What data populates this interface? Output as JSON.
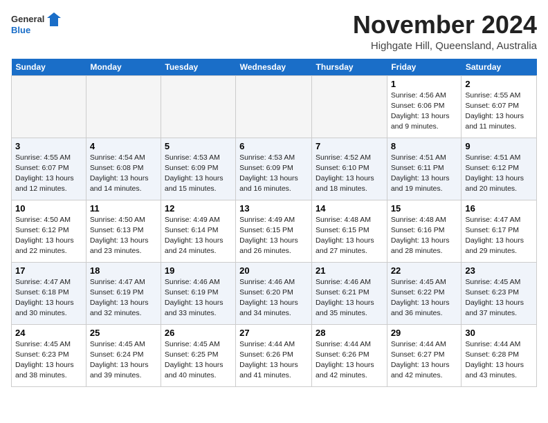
{
  "logo": {
    "general": "General",
    "blue": "Blue"
  },
  "title": "November 2024",
  "subtitle": "Highgate Hill, Queensland, Australia",
  "days_of_week": [
    "Sunday",
    "Monday",
    "Tuesday",
    "Wednesday",
    "Thursday",
    "Friday",
    "Saturday"
  ],
  "weeks": [
    [
      {
        "day": "",
        "info": ""
      },
      {
        "day": "",
        "info": ""
      },
      {
        "day": "",
        "info": ""
      },
      {
        "day": "",
        "info": ""
      },
      {
        "day": "",
        "info": ""
      },
      {
        "day": "1",
        "info": "Sunrise: 4:56 AM\nSunset: 6:06 PM\nDaylight: 13 hours\nand 9 minutes."
      },
      {
        "day": "2",
        "info": "Sunrise: 4:55 AM\nSunset: 6:07 PM\nDaylight: 13 hours\nand 11 minutes."
      }
    ],
    [
      {
        "day": "3",
        "info": "Sunrise: 4:55 AM\nSunset: 6:07 PM\nDaylight: 13 hours\nand 12 minutes."
      },
      {
        "day": "4",
        "info": "Sunrise: 4:54 AM\nSunset: 6:08 PM\nDaylight: 13 hours\nand 14 minutes."
      },
      {
        "day": "5",
        "info": "Sunrise: 4:53 AM\nSunset: 6:09 PM\nDaylight: 13 hours\nand 15 minutes."
      },
      {
        "day": "6",
        "info": "Sunrise: 4:53 AM\nSunset: 6:09 PM\nDaylight: 13 hours\nand 16 minutes."
      },
      {
        "day": "7",
        "info": "Sunrise: 4:52 AM\nSunset: 6:10 PM\nDaylight: 13 hours\nand 18 minutes."
      },
      {
        "day": "8",
        "info": "Sunrise: 4:51 AM\nSunset: 6:11 PM\nDaylight: 13 hours\nand 19 minutes."
      },
      {
        "day": "9",
        "info": "Sunrise: 4:51 AM\nSunset: 6:12 PM\nDaylight: 13 hours\nand 20 minutes."
      }
    ],
    [
      {
        "day": "10",
        "info": "Sunrise: 4:50 AM\nSunset: 6:12 PM\nDaylight: 13 hours\nand 22 minutes."
      },
      {
        "day": "11",
        "info": "Sunrise: 4:50 AM\nSunset: 6:13 PM\nDaylight: 13 hours\nand 23 minutes."
      },
      {
        "day": "12",
        "info": "Sunrise: 4:49 AM\nSunset: 6:14 PM\nDaylight: 13 hours\nand 24 minutes."
      },
      {
        "day": "13",
        "info": "Sunrise: 4:49 AM\nSunset: 6:15 PM\nDaylight: 13 hours\nand 26 minutes."
      },
      {
        "day": "14",
        "info": "Sunrise: 4:48 AM\nSunset: 6:15 PM\nDaylight: 13 hours\nand 27 minutes."
      },
      {
        "day": "15",
        "info": "Sunrise: 4:48 AM\nSunset: 6:16 PM\nDaylight: 13 hours\nand 28 minutes."
      },
      {
        "day": "16",
        "info": "Sunrise: 4:47 AM\nSunset: 6:17 PM\nDaylight: 13 hours\nand 29 minutes."
      }
    ],
    [
      {
        "day": "17",
        "info": "Sunrise: 4:47 AM\nSunset: 6:18 PM\nDaylight: 13 hours\nand 30 minutes."
      },
      {
        "day": "18",
        "info": "Sunrise: 4:47 AM\nSunset: 6:19 PM\nDaylight: 13 hours\nand 32 minutes."
      },
      {
        "day": "19",
        "info": "Sunrise: 4:46 AM\nSunset: 6:19 PM\nDaylight: 13 hours\nand 33 minutes."
      },
      {
        "day": "20",
        "info": "Sunrise: 4:46 AM\nSunset: 6:20 PM\nDaylight: 13 hours\nand 34 minutes."
      },
      {
        "day": "21",
        "info": "Sunrise: 4:46 AM\nSunset: 6:21 PM\nDaylight: 13 hours\nand 35 minutes."
      },
      {
        "day": "22",
        "info": "Sunrise: 4:45 AM\nSunset: 6:22 PM\nDaylight: 13 hours\nand 36 minutes."
      },
      {
        "day": "23",
        "info": "Sunrise: 4:45 AM\nSunset: 6:23 PM\nDaylight: 13 hours\nand 37 minutes."
      }
    ],
    [
      {
        "day": "24",
        "info": "Sunrise: 4:45 AM\nSunset: 6:23 PM\nDaylight: 13 hours\nand 38 minutes."
      },
      {
        "day": "25",
        "info": "Sunrise: 4:45 AM\nSunset: 6:24 PM\nDaylight: 13 hours\nand 39 minutes."
      },
      {
        "day": "26",
        "info": "Sunrise: 4:45 AM\nSunset: 6:25 PM\nDaylight: 13 hours\nand 40 minutes."
      },
      {
        "day": "27",
        "info": "Sunrise: 4:44 AM\nSunset: 6:26 PM\nDaylight: 13 hours\nand 41 minutes."
      },
      {
        "day": "28",
        "info": "Sunrise: 4:44 AM\nSunset: 6:26 PM\nDaylight: 13 hours\nand 42 minutes."
      },
      {
        "day": "29",
        "info": "Sunrise: 4:44 AM\nSunset: 6:27 PM\nDaylight: 13 hours\nand 42 minutes."
      },
      {
        "day": "30",
        "info": "Sunrise: 4:44 AM\nSunset: 6:28 PM\nDaylight: 13 hours\nand 43 minutes."
      }
    ]
  ]
}
